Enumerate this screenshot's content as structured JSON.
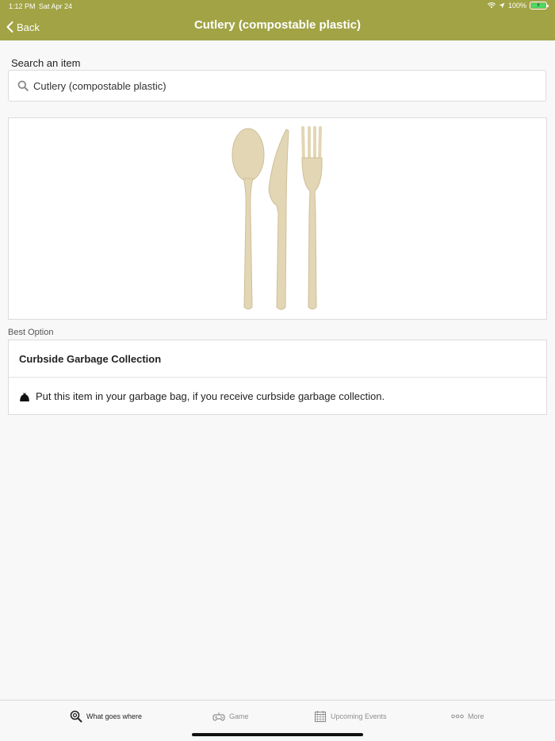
{
  "status_bar": {
    "time": "1:12 PM",
    "date": "Sat Apr 24",
    "battery": "100%"
  },
  "nav": {
    "back_label": "Back",
    "title": "Cutlery (compostable plastic)"
  },
  "search": {
    "label": "Search an item",
    "value": "Cutlery (compostable plastic)"
  },
  "best_option": {
    "section_label": "Best Option",
    "title": "Curbside Garbage Collection",
    "instruction": "Put this item in your garbage bag, if you receive curbside garbage collection.",
    "icon": "garbage-bag-icon"
  },
  "tabs": [
    {
      "label": "What goes where",
      "icon": "search-icon",
      "active": true
    },
    {
      "label": "Game",
      "icon": "gamepad-icon",
      "active": false
    },
    {
      "label": "Upcoming Events",
      "icon": "calendar-icon",
      "active": false
    },
    {
      "label": "More",
      "icon": "more-icon",
      "active": false
    }
  ],
  "colors": {
    "header": "#a1a345",
    "background": "#f7f8f7",
    "cutlery": "#e3d6b4"
  }
}
